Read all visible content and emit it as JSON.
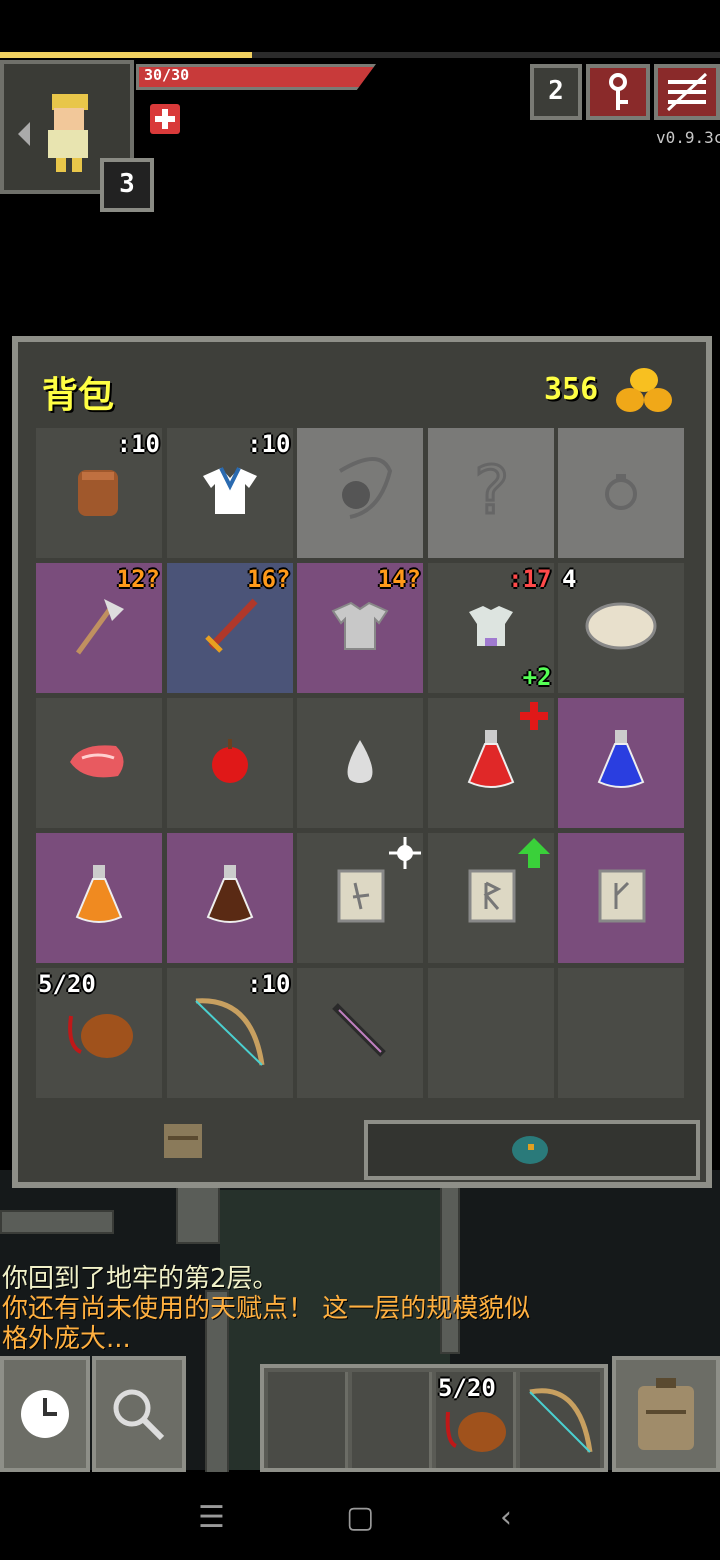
{
  "hud": {
    "hp_text": "30/30",
    "hero_level": "3",
    "depth": "2",
    "version": "v0.9.3c",
    "xp_fraction": 0.35,
    "hp_fraction": 1.0
  },
  "backpack": {
    "title": "背包",
    "gold": "356",
    "slots": [
      {
        "item": "gloves",
        "tag": ":10",
        "tag_color": "white",
        "bg": "def"
      },
      {
        "item": "cloth-armor",
        "tag": ":10",
        "tag_color": "white",
        "bg": "def"
      },
      {
        "item": "weapon-placeholder",
        "tag": "",
        "bg": "eq"
      },
      {
        "item": "unknown-placeholder",
        "tag": "",
        "bg": "eq"
      },
      {
        "item": "ring-placeholder",
        "tag": "",
        "bg": "eq"
      },
      {
        "item": "hand-axe",
        "tag": "12?",
        "tag_color": "orange",
        "bg": "purple"
      },
      {
        "item": "sword",
        "tag": "16?",
        "tag_color": "orange",
        "bg": "blue"
      },
      {
        "item": "chainmail",
        "tag": "14?",
        "tag_color": "orange",
        "bg": "purple"
      },
      {
        "item": "mail-armor",
        "tag": ":17",
        "tag_color": "red",
        "tag2": "+2",
        "tag2_color": "green",
        "bg": "def"
      },
      {
        "item": "ration",
        "tag": "4",
        "tag_color": "white",
        "bg": "def"
      },
      {
        "item": "mystery-meat",
        "tag": "",
        "bg": "def"
      },
      {
        "item": "apple",
        "tag": "",
        "bg": "def"
      },
      {
        "item": "seed",
        "tag": "",
        "bg": "def"
      },
      {
        "item": "healing-potion",
        "tag": "",
        "bg": "def"
      },
      {
        "item": "blue-potion",
        "tag": "",
        "bg": "purple"
      },
      {
        "item": "orange-potion",
        "tag": "",
        "bg": "purple"
      },
      {
        "item": "brown-potion",
        "tag": "",
        "bg": "purple"
      },
      {
        "item": "scroll-1",
        "tag": "",
        "bg": "def"
      },
      {
        "item": "scroll-2",
        "tag": "",
        "bg": "def"
      },
      {
        "item": "scroll-3",
        "tag": "",
        "bg": "purple"
      },
      {
        "item": "waterskin",
        "tag": "5/20",
        "tag_color": "white",
        "bg": "def"
      },
      {
        "item": "bow",
        "tag": ":10",
        "tag_color": "white",
        "bg": "def"
      },
      {
        "item": "dart-wand",
        "tag": "",
        "bg": "def"
      },
      {
        "item": "empty",
        "tag": "",
        "bg": "def"
      },
      {
        "item": "empty",
        "tag": "",
        "bg": "def"
      }
    ]
  },
  "log": {
    "line1": "你回到了地牢的第2层。",
    "line2": "你还有尚未使用的天赋点！ 这一层的规模貌似",
    "line3": "格外庞大..."
  },
  "toolbar": {
    "quickslot_tag": "5/20"
  },
  "colors": {
    "gold_text": "#ffff44",
    "log_white": "#f0f0c8",
    "log_orange": "#ffb040"
  }
}
